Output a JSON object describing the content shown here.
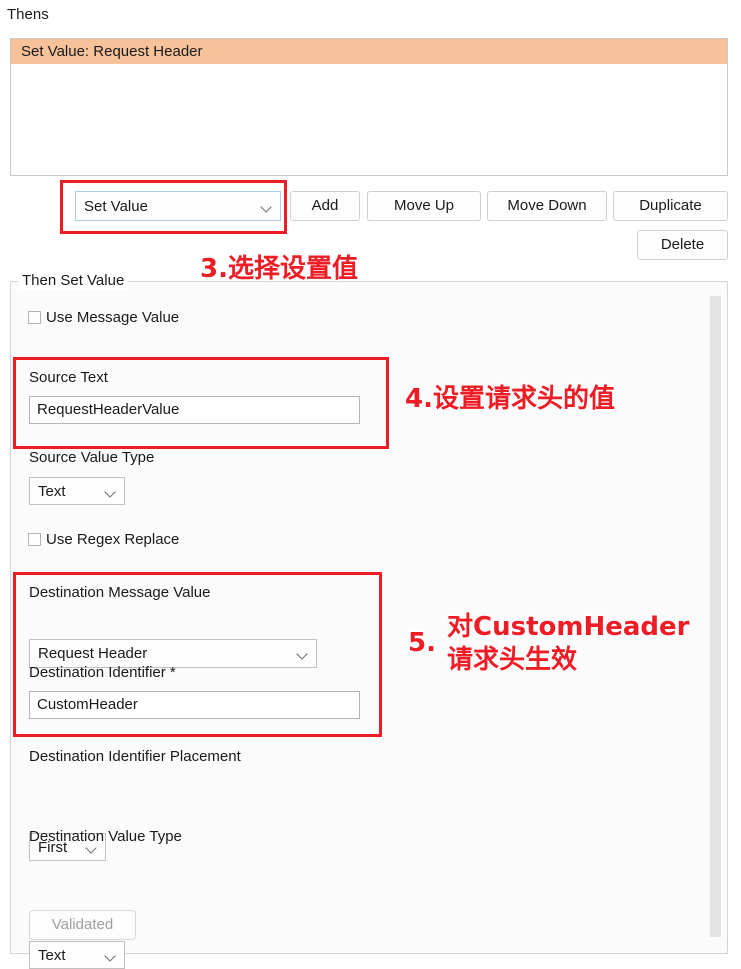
{
  "section": {
    "thens_label": "Thens",
    "list_items": [
      {
        "text": "Set Value: Request Header",
        "selected": true,
        "highlight_color": "#f7c199"
      }
    ]
  },
  "toolbar": {
    "action_combo": {
      "value": "Set Value",
      "icon": "chevron-down-icon"
    },
    "add_label": "Add",
    "move_up_label": "Move Up",
    "move_down_label": "Move Down",
    "duplicate_label": "Duplicate",
    "delete_label": "Delete"
  },
  "groupbox": {
    "title": "Then Set Value",
    "use_message_value": {
      "label": "Use Message Value",
      "checked": false
    },
    "source_text": {
      "label": "Source Text",
      "value": "RequestHeaderValue"
    },
    "source_value_type": {
      "label": "Source Value Type",
      "value": "Text"
    },
    "use_regex_replace": {
      "label": "Use Regex Replace",
      "checked": false
    },
    "destination_message_value": {
      "label": "Destination Message Value",
      "value": "Request Header"
    },
    "destination_identifier": {
      "label": "Destination Identifier *",
      "value": "CustomHeader"
    },
    "destination_identifier_placement": {
      "label": "Destination Identifier Placement",
      "value": "First"
    },
    "destination_value_type": {
      "label": "Destination Value Type",
      "value": "Text"
    },
    "validated_button": {
      "label": "Validated",
      "disabled": true
    }
  },
  "annotations": {
    "color": "#ee1c25",
    "step3": "3.选择设置值",
    "step4": "4.设置请求头的值",
    "step5_number": "5.",
    "step5_line1": "对CustomHeader",
    "step5_line2": "请求头生效"
  }
}
